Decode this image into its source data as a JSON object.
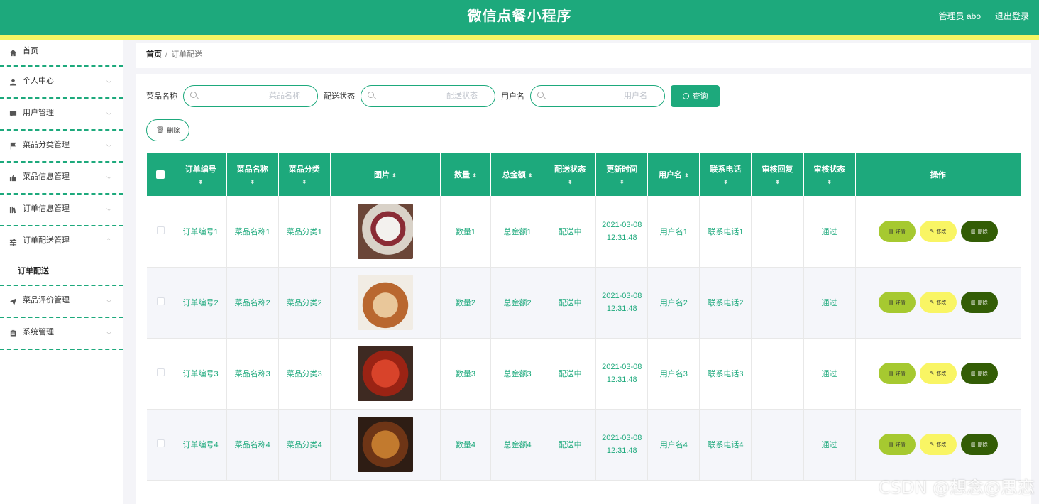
{
  "header": {
    "title": "微信点餐小程序",
    "user": "管理员 abo",
    "logout": "退出登录"
  },
  "colors": {
    "primary": "#1da97c",
    "accent_line": "#f5f564",
    "detail_btn": "#a6c930",
    "edit_btn": "#f9f564",
    "delete_btn": "#335d06"
  },
  "sidebar": {
    "items": [
      {
        "label": "首页",
        "icon": "home-icon"
      },
      {
        "label": "个人中心",
        "icon": "user-icon"
      },
      {
        "label": "用户管理",
        "icon": "chat-icon"
      },
      {
        "label": "菜品分类管理",
        "icon": "flag-icon"
      },
      {
        "label": "菜品信息管理",
        "icon": "thumb-icon"
      },
      {
        "label": "订单信息管理",
        "icon": "books-icon"
      },
      {
        "label": "订单配送管理",
        "icon": "sliders-icon",
        "submenu": "订单配送"
      },
      {
        "label": "菜品评价管理",
        "icon": "send-icon"
      },
      {
        "label": "系统管理",
        "icon": "clipboard-icon"
      }
    ]
  },
  "breadcrumb": {
    "home": "首页",
    "sep": "/",
    "current": "订单配送"
  },
  "search": {
    "dish_label": "菜品名称",
    "dish_placeholder": "菜品名称",
    "status_label": "配送状态",
    "status_placeholder": "配送状态",
    "user_label": "用户名",
    "user_placeholder": "用户名",
    "query_btn": "查询"
  },
  "delete_btn": "删除",
  "table": {
    "headers": [
      "订单编号",
      "菜品名称",
      "菜品分类",
      "图片",
      "数量",
      "总金额",
      "配送状态",
      "更新时间",
      "用户名",
      "联系电话",
      "审核回复",
      "审核状态",
      "操作"
    ],
    "sort_glyph": "⬍",
    "rows": [
      {
        "order": "订单编号1",
        "dish": "菜品名称1",
        "cat": "菜品分类1",
        "qty": "数量1",
        "total": "总金额1",
        "status": "配送中",
        "date": "2021-03-08",
        "time": "12:31:48",
        "user": "用户名1",
        "phone": "联系电话1",
        "reply": "",
        "audit": "通过"
      },
      {
        "order": "订单编号2",
        "dish": "菜品名称2",
        "cat": "菜品分类2",
        "qty": "数量2",
        "total": "总金额2",
        "status": "配送中",
        "date": "2021-03-08",
        "time": "12:31:48",
        "user": "用户名2",
        "phone": "联系电话2",
        "reply": "",
        "audit": "通过"
      },
      {
        "order": "订单编号3",
        "dish": "菜品名称3",
        "cat": "菜品分类3",
        "qty": "数量3",
        "total": "总金额3",
        "status": "配送中",
        "date": "2021-03-08",
        "time": "12:31:48",
        "user": "用户名3",
        "phone": "联系电话3",
        "reply": "",
        "audit": "通过"
      },
      {
        "order": "订单编号4",
        "dish": "菜品名称4",
        "cat": "菜品分类4",
        "qty": "数量4",
        "total": "总金额4",
        "status": "配送中",
        "date": "2021-03-08",
        "time": "12:31:48",
        "user": "用户名4",
        "phone": "联系电话4",
        "reply": "",
        "audit": "通过"
      }
    ],
    "actions": {
      "detail": "详情",
      "edit": "修改",
      "delete": "删除"
    }
  },
  "watermark": "CSDN @想念@思恋"
}
